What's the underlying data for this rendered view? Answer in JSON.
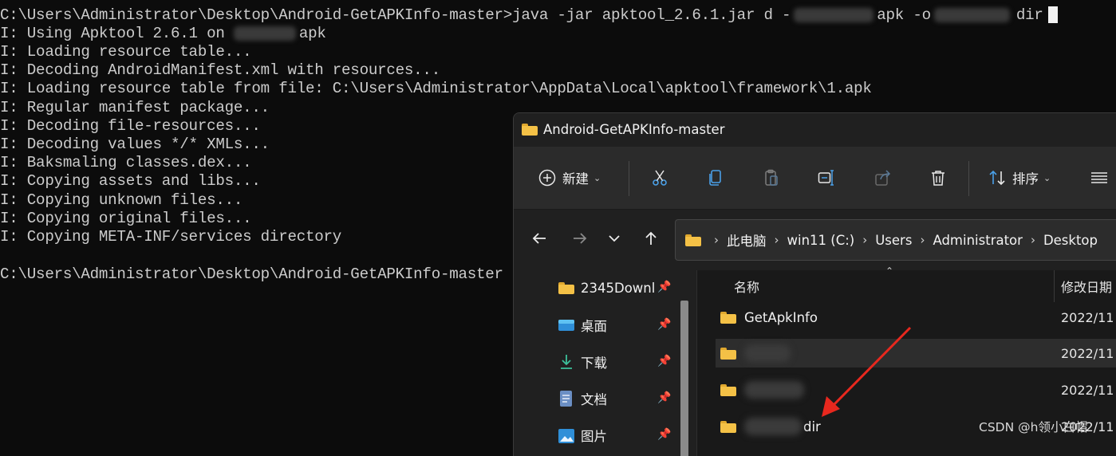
{
  "terminal": {
    "cmd_prefix": "C:\\Users\\Administrator\\Desktop\\Android-GetAPKInfo-master>java -jar apktool_2.6.1.jar d -",
    "cmd_apk": "apk -o",
    "cmd_dir": "dir",
    "using_prefix": "I: Using Apktool 2.6.1 on ",
    "using_suffix": "apk",
    "lines": [
      "I: Loading resource table...",
      "I: Decoding AndroidManifest.xml with resources...",
      "I: Loading resource table from file: C:\\Users\\Administrator\\AppData\\Local\\apktool\\framework\\1.apk",
      "I: Regular manifest package...",
      "I: Decoding file-resources...",
      "I: Decoding values */* XMLs...",
      "I: Baksmaling classes.dex...",
      "I: Copying assets and libs...",
      "I: Copying unknown files...",
      "I: Copying original files...",
      "I: Copying META-INF/services directory"
    ],
    "prompt": "C:\\Users\\Administrator\\Desktop\\Android-GetAPKInfo-master"
  },
  "explorer": {
    "title": "Android-GetAPKInfo-master",
    "toolbar": {
      "new_label": "新建",
      "sort_label": "排序",
      "icons": [
        "plus-circle-icon",
        "cut-icon",
        "copy-icon",
        "paste-icon",
        "rename-icon",
        "share-icon",
        "delete-icon",
        "sort-icon",
        "view-icon"
      ]
    },
    "breadcrumb": [
      "此电脑",
      "win11 (C:)",
      "Users",
      "Administrator",
      "Desktop"
    ],
    "sidebar": [
      {
        "label": "2345Downl",
        "icon": "folder-icon"
      },
      {
        "label": "桌面",
        "icon": "desktop-icon"
      },
      {
        "label": "下载",
        "icon": "download-icon"
      },
      {
        "label": "文档",
        "icon": "document-icon"
      },
      {
        "label": "图片",
        "icon": "picture-icon"
      }
    ],
    "columns": {
      "name": "名称",
      "modified": "修改日期"
    },
    "files": [
      {
        "name": "GetApkInfo",
        "date": "2022/11"
      },
      {
        "name": "",
        "date": "2022/11"
      },
      {
        "name": "",
        "date": "2022/11"
      },
      {
        "name": "dir",
        "date": "2022/11"
      }
    ]
  },
  "annotation": {
    "arrow_color": "#e8281e"
  },
  "watermark": "CSDN @h领小白帽"
}
